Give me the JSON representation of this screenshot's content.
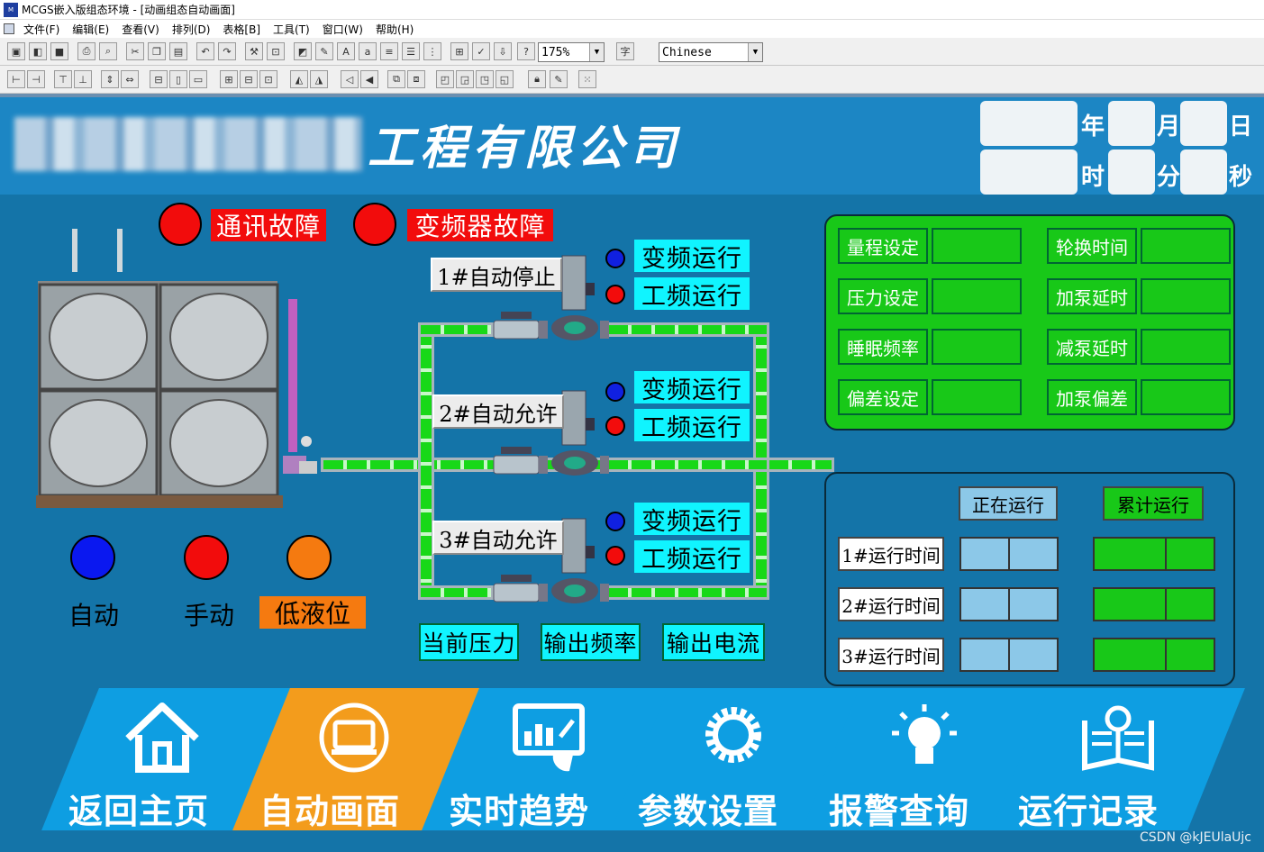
{
  "window": {
    "title": "MCGS嵌入版组态环境 - [动画组态自动画面]"
  },
  "menu": [
    "文件(F)",
    "编辑(E)",
    "查看(V)",
    "排列(D)",
    "表格[B]",
    "工具(T)",
    "窗口(W)",
    "帮助(H)"
  ],
  "toolbar": {
    "zoom": "175%",
    "language": "Chinese"
  },
  "header": {
    "company_suffix": "工程有限公司",
    "date_labels": {
      "year": "年",
      "month": "月",
      "day": "日",
      "hour": "时",
      "minute": "分",
      "second": "秒"
    }
  },
  "alarms": {
    "comm_fault": "通讯故障",
    "vfd_fault": "变频器故障"
  },
  "pumps": [
    {
      "name": "1#自动停止",
      "vf_run": "变频运行",
      "pf_run": "工频运行"
    },
    {
      "name": "2#自动允许",
      "vf_run": "变频运行",
      "pf_run": "工频运行"
    },
    {
      "name": "3#自动允许",
      "vf_run": "变频运行",
      "pf_run": "工频运行"
    }
  ],
  "modes": {
    "auto": "自动",
    "manual": "手动",
    "low_level": "低液位"
  },
  "readouts": {
    "pressure": "当前压力",
    "frequency": "输出频率",
    "current": "输出电流"
  },
  "params": {
    "left": [
      "量程设定",
      "压力设定",
      "睡眠频率",
      "偏差设定"
    ],
    "right": [
      "轮换时间",
      "加泵延时",
      "减泵延时",
      "加泵偏差"
    ]
  },
  "runtime": {
    "col_running": "正在运行",
    "col_total": "累计运行",
    "rows": [
      "1#运行时间",
      "2#运行时间",
      "3#运行时间"
    ]
  },
  "nav": [
    {
      "label": "返回主页",
      "icon": "home-icon"
    },
    {
      "label": "自动画面",
      "icon": "monitor-icon"
    },
    {
      "label": "实时趋势",
      "icon": "trend-icon"
    },
    {
      "label": "参数设置",
      "icon": "gear-icon"
    },
    {
      "label": "报警查询",
      "icon": "bulb-icon"
    },
    {
      "label": "运行记录",
      "icon": "book-icon"
    }
  ],
  "watermark": "CSDN @kJEUlaUjc",
  "colors": {
    "background": "#1474a8",
    "header": "#1c86c4",
    "fault_red": "#f20c0c",
    "status_cyan": "#10f4ff",
    "panel_green": "#18c818",
    "nav_blue": "#0e9ee2",
    "nav_active": "#f39c1c"
  }
}
